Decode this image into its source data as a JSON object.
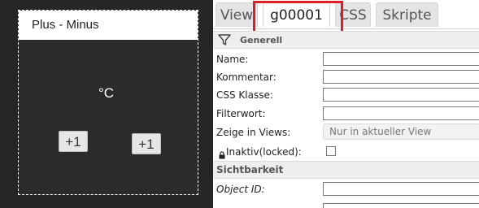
{
  "widget": {
    "title": "Plus - Minus",
    "unit": "°C",
    "button_left": "+1",
    "button_right": "+1"
  },
  "tabs": [
    {
      "label": "View"
    },
    {
      "label": "g00001"
    },
    {
      "label": "CSS"
    },
    {
      "label": "Skripte"
    }
  ],
  "sections": {
    "general": "Generell",
    "visibility": "Sichtbarkeit"
  },
  "fields": {
    "name": "Name:",
    "comment": "Kommentar:",
    "css_class": "CSS Klasse:",
    "filter_word": "Filterwort:",
    "show_in_views": "Zeige in Views:",
    "show_in_views_value": "Nur in aktueller View",
    "inactive": "Inaktiv(locked):",
    "object_id": "Object ID:"
  },
  "icons": {
    "filter": "filter-icon",
    "lock": "lock-icon"
  },
  "colors": {
    "highlight": "#d9202a",
    "canvas": "#262626"
  }
}
